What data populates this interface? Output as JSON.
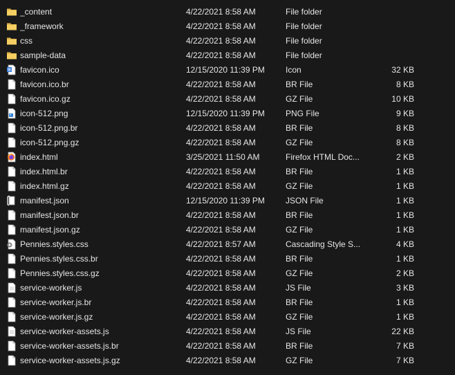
{
  "files": [
    {
      "name": "_content",
      "date": "4/22/2021 8:58 AM",
      "type": "File folder",
      "size": "",
      "icon": "folder-icon"
    },
    {
      "name": "_framework",
      "date": "4/22/2021 8:58 AM",
      "type": "File folder",
      "size": "",
      "icon": "folder-icon"
    },
    {
      "name": "css",
      "date": "4/22/2021 8:58 AM",
      "type": "File folder",
      "size": "",
      "icon": "folder-icon"
    },
    {
      "name": "sample-data",
      "date": "4/22/2021 8:58 AM",
      "type": "File folder",
      "size": "",
      "icon": "folder-icon"
    },
    {
      "name": "favicon.ico",
      "date": "12/15/2020 11:39 PM",
      "type": "Icon",
      "size": "32 KB",
      "icon": "ico-file-icon"
    },
    {
      "name": "favicon.ico.br",
      "date": "4/22/2021 8:58 AM",
      "type": "BR File",
      "size": "8 KB",
      "icon": "file-icon"
    },
    {
      "name": "favicon.ico.gz",
      "date": "4/22/2021 8:58 AM",
      "type": "GZ File",
      "size": "10 KB",
      "icon": "file-icon"
    },
    {
      "name": "icon-512.png",
      "date": "12/15/2020 11:39 PM",
      "type": "PNG File",
      "size": "9 KB",
      "icon": "image-file-icon"
    },
    {
      "name": "icon-512.png.br",
      "date": "4/22/2021 8:58 AM",
      "type": "BR File",
      "size": "8 KB",
      "icon": "file-icon"
    },
    {
      "name": "icon-512.png.gz",
      "date": "4/22/2021 8:58 AM",
      "type": "GZ File",
      "size": "8 KB",
      "icon": "file-icon"
    },
    {
      "name": "index.html",
      "date": "3/25/2021 11:50 AM",
      "type": "Firefox HTML Doc...",
      "size": "2 KB",
      "icon": "firefox-icon"
    },
    {
      "name": "index.html.br",
      "date": "4/22/2021 8:58 AM",
      "type": "BR File",
      "size": "1 KB",
      "icon": "file-icon"
    },
    {
      "name": "index.html.gz",
      "date": "4/22/2021 8:58 AM",
      "type": "GZ File",
      "size": "1 KB",
      "icon": "file-icon"
    },
    {
      "name": "manifest.json",
      "date": "12/15/2020 11:39 PM",
      "type": "JSON File",
      "size": "1 KB",
      "icon": "json-file-icon"
    },
    {
      "name": "manifest.json.br",
      "date": "4/22/2021 8:58 AM",
      "type": "BR File",
      "size": "1 KB",
      "icon": "file-icon"
    },
    {
      "name": "manifest.json.gz",
      "date": "4/22/2021 8:58 AM",
      "type": "GZ File",
      "size": "1 KB",
      "icon": "file-icon"
    },
    {
      "name": "Pennies.styles.css",
      "date": "4/22/2021 8:57 AM",
      "type": "Cascading Style S...",
      "size": "4 KB",
      "icon": "css-file-icon"
    },
    {
      "name": "Pennies.styles.css.br",
      "date": "4/22/2021 8:58 AM",
      "type": "BR File",
      "size": "1 KB",
      "icon": "file-icon"
    },
    {
      "name": "Pennies.styles.css.gz",
      "date": "4/22/2021 8:58 AM",
      "type": "GZ File",
      "size": "2 KB",
      "icon": "file-icon"
    },
    {
      "name": "service-worker.js",
      "date": "4/22/2021 8:58 AM",
      "type": "JS File",
      "size": "3 KB",
      "icon": "js-file-icon"
    },
    {
      "name": "service-worker.js.br",
      "date": "4/22/2021 8:58 AM",
      "type": "BR File",
      "size": "1 KB",
      "icon": "file-icon"
    },
    {
      "name": "service-worker.js.gz",
      "date": "4/22/2021 8:58 AM",
      "type": "GZ File",
      "size": "1 KB",
      "icon": "file-icon"
    },
    {
      "name": "service-worker-assets.js",
      "date": "4/22/2021 8:58 AM",
      "type": "JS File",
      "size": "22 KB",
      "icon": "js-file-icon"
    },
    {
      "name": "service-worker-assets.js.br",
      "date": "4/22/2021 8:58 AM",
      "type": "BR File",
      "size": "7 KB",
      "icon": "file-icon"
    },
    {
      "name": "service-worker-assets.js.gz",
      "date": "4/22/2021 8:58 AM",
      "type": "GZ File",
      "size": "7 KB",
      "icon": "file-icon"
    }
  ]
}
